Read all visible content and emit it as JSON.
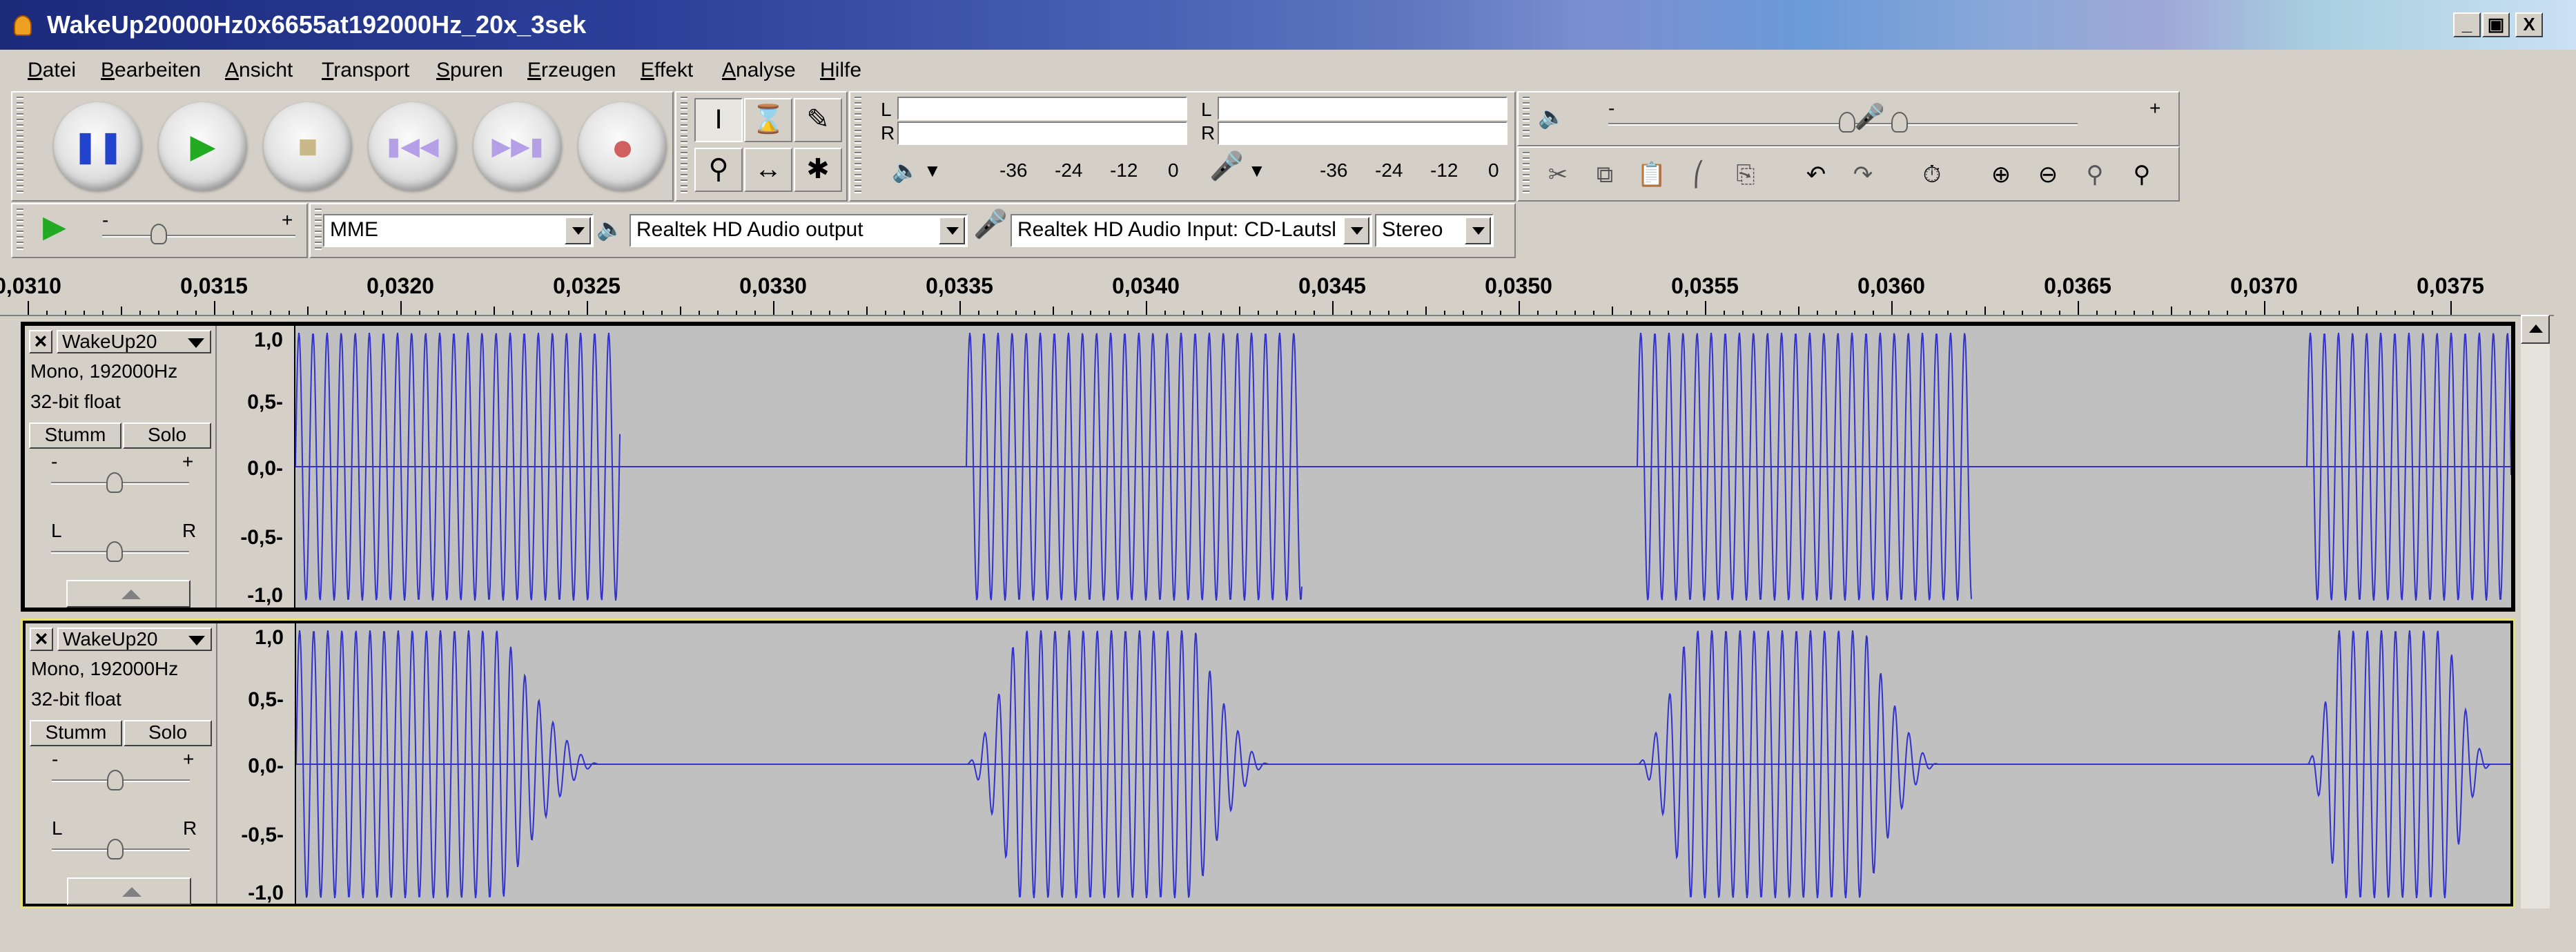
{
  "window": {
    "title": "WakeUp20000Hz0x6655at192000Hz_20x_3sek",
    "btn_min": "_",
    "btn_max": "▣",
    "btn_close": "X"
  },
  "menu": [
    "Datei",
    "Bearbeiten",
    "Ansicht",
    "Transport",
    "Spuren",
    "Erzeugen",
    "Effekt",
    "Analyse",
    "Hilfe"
  ],
  "meters": {
    "play_L": "L",
    "play_R": "R",
    "rec_L": "L",
    "rec_R": "R",
    "play_scale": [
      "-36",
      "-24",
      "-12",
      "0"
    ],
    "rec_scale": [
      "-36",
      "-24",
      "-12",
      "0"
    ]
  },
  "mixer": {
    "minus": "-",
    "plus": "+"
  },
  "device": {
    "host": "MME",
    "output": "Realtek HD Audio output",
    "input": "Realtek HD Audio Input: CD-Lautsl",
    "channels": "Stereo",
    "speed_minus": "-",
    "speed_plus": "+"
  },
  "ruler": {
    "labels": [
      "0,0310",
      "0,0315",
      "0,0320",
      "0,0325",
      "0,0330",
      "0,0335",
      "0,0340",
      "0,0345",
      "0,0350",
      "0,0355",
      "0,0360",
      "0,0365",
      "0,0370",
      "0,0375"
    ]
  },
  "tracks": [
    {
      "name": "WakeUp20",
      "format": "Mono, 192000Hz",
      "bits": "32-bit float",
      "mute": "Stumm",
      "solo": "Solo",
      "gain_minus": "-",
      "gain_plus": "+",
      "pan_left": "L",
      "pan_right": "R",
      "scale": [
        "1,0",
        "0,5-",
        "0,0-",
        "-0,5-",
        "-1,0"
      ]
    },
    {
      "name": "WakeUp20",
      "format": "Mono, 192000Hz",
      "bits": "32-bit float",
      "mute": "Stumm",
      "solo": "Solo",
      "gain_minus": "-",
      "gain_plus": "+",
      "pan_left": "L",
      "pan_right": "R",
      "scale": [
        "1,0",
        "0,5-",
        "0,0-",
        "-0,5-",
        "-1,0"
      ]
    }
  ],
  "colors": {
    "waveform": "#3333cc",
    "selected_border": "#e8e070"
  }
}
